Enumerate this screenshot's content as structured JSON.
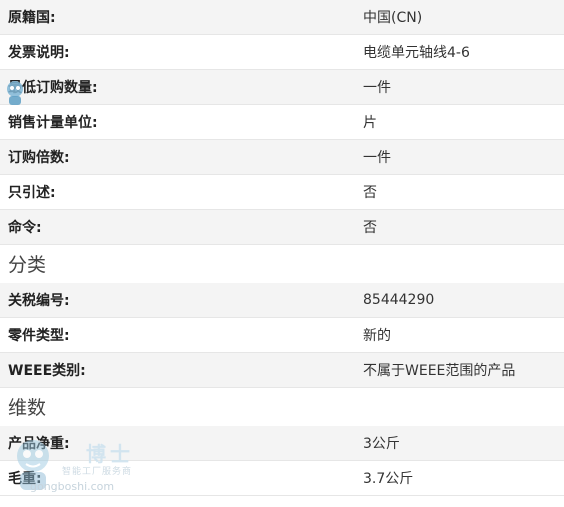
{
  "rows_top": [
    {
      "label": "原籍国:",
      "value": "中国(CN)"
    },
    {
      "label": "发票说明:",
      "value": "电缆单元轴线4-6"
    },
    {
      "label": "最低订购数量:",
      "value": "一件"
    },
    {
      "label": "销售计量单位:",
      "value": "片"
    },
    {
      "label": "订购倍数:",
      "value": "一件"
    },
    {
      "label": "只引述:",
      "value": "否"
    },
    {
      "label": "命令:",
      "value": "否"
    }
  ],
  "section_classification": "分类",
  "rows_classification": [
    {
      "label": "关税编号:",
      "value": "85444290"
    },
    {
      "label": "零件类型:",
      "value": "新的"
    },
    {
      "label": "WEEE类别:",
      "value": "不属于WEEE范围的产品"
    }
  ],
  "section_dimensions": "维数",
  "rows_dimensions": [
    {
      "label": "产品净重:",
      "value": "3公斤"
    },
    {
      "label": "毛重:",
      "value": "3.7公斤"
    }
  ],
  "watermark": {
    "name": "博士",
    "subtitle": "智能工厂服务商",
    "url": "gongboshi.com",
    "color": "#9cc8e0"
  }
}
